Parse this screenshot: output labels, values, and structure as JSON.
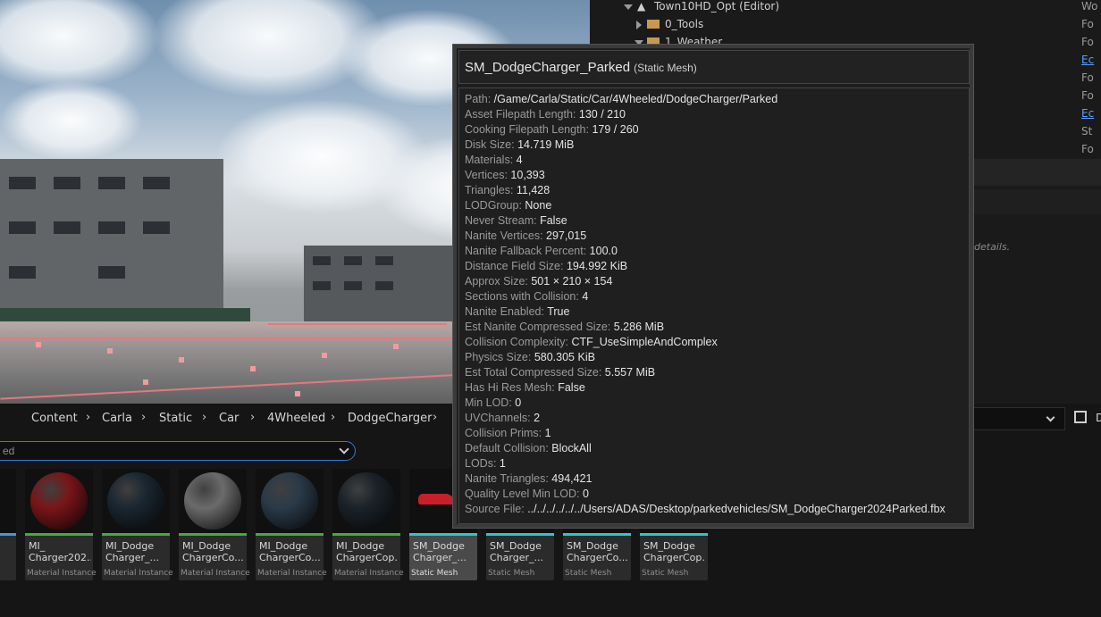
{
  "outliner": {
    "rows": [
      {
        "label": "Town10HD_Opt (Editor)",
        "type": "Wo"
      },
      {
        "label": "0_Tools",
        "type": "Fo"
      },
      {
        "label": "1_Weather",
        "type": "Fo"
      },
      {
        "label": "",
        "type": "Ec"
      },
      {
        "label": "",
        "type": "Fo"
      },
      {
        "label": "",
        "type": "Fo"
      },
      {
        "label": "",
        "type": "Ec"
      },
      {
        "label": "",
        "type": "St"
      },
      {
        "label": "",
        "type": "Fo"
      }
    ],
    "hint": "y details."
  },
  "breadcrumb": [
    "Content",
    "Carla",
    "Static",
    "Car",
    "4Wheeled",
    "DodgeCharger"
  ],
  "filter": {
    "value": "ed"
  },
  "right_label": "D",
  "tiles": [
    {
      "name": "",
      "kind": "s",
      "bar": "#3b9be0",
      "thumb": "#0a0a0a"
    },
    {
      "name": "MI_\nCharger202...",
      "kind": "Material Instance",
      "bar": "#3fae3a",
      "thumb": "#7a1518"
    },
    {
      "name": "MI_Dodge\nCharger_...",
      "kind": "Material Instance",
      "bar": "#3fae3a",
      "thumb": "#1a2630"
    },
    {
      "name": "MI_Dodge\nChargerCo...",
      "kind": "Material Instance",
      "bar": "#3fae3a",
      "thumb": "#6b6b6b"
    },
    {
      "name": "MI_Dodge\nChargerCo...",
      "kind": "Material Instance",
      "bar": "#3fae3a",
      "thumb": "#2a3a48"
    },
    {
      "name": "MI_Dodge\nChargerCop...",
      "kind": "Material Instance",
      "bar": "#3fae3a",
      "thumb": "#1a2228"
    },
    {
      "name": "SM_Dodge\nCharger_...",
      "kind": "Static Mesh",
      "bar": "#23c8d8",
      "thumb": "#151515",
      "selected": true
    },
    {
      "name": "SM_Dodge\nCharger_...",
      "kind": "Static Mesh",
      "bar": "#23c8d8",
      "thumb": "#151515"
    },
    {
      "name": "SM_Dodge\nChargerCo...",
      "kind": "Static Mesh",
      "bar": "#23c8d8",
      "thumb": "#151515"
    },
    {
      "name": "SM_Dodge\nChargerCop...",
      "kind": "Static Mesh",
      "bar": "#23c8d8",
      "thumb": "#151515"
    }
  ],
  "tooltip": {
    "title": "SM_DodgeCharger_Parked",
    "type": "(Static Mesh)",
    "rows": [
      {
        "k": "Path:",
        "v": "/Game/Carla/Static/Car/4Wheeled/DodgeCharger/Parked"
      },
      {
        "k": "Asset Filepath Length:",
        "v": "130 / 210"
      },
      {
        "k": "Cooking Filepath Length:",
        "v": "179 / 260"
      },
      {
        "k": "Disk Size:",
        "v": "14.719 MiB"
      },
      {
        "k": "Materials:",
        "v": "4"
      },
      {
        "k": "Vertices:",
        "v": "10,393"
      },
      {
        "k": "Triangles:",
        "v": "11,428"
      },
      {
        "k": "LODGroup:",
        "v": "None"
      },
      {
        "k": "Never Stream:",
        "v": "False"
      },
      {
        "k": "Nanite Vertices:",
        "v": "297,015"
      },
      {
        "k": "Nanite Fallback Percent:",
        "v": "100.0"
      },
      {
        "k": "Distance Field Size:",
        "v": "194.992 KiB"
      },
      {
        "k": "Approx Size:",
        "v": "501 × 210 × 154"
      },
      {
        "k": "Sections with Collision:",
        "v": "4"
      },
      {
        "k": "Nanite Enabled:",
        "v": "True"
      },
      {
        "k": "Est Nanite Compressed Size:",
        "v": "5.286 MiB"
      },
      {
        "k": "Collision Complexity:",
        "v": "CTF_UseSimpleAndComplex"
      },
      {
        "k": "Physics Size:",
        "v": "580.305 KiB"
      },
      {
        "k": "Est Total Compressed Size:",
        "v": "5.557 MiB"
      },
      {
        "k": "Has Hi Res Mesh:",
        "v": "False"
      },
      {
        "k": "Min LOD:",
        "v": "0"
      },
      {
        "k": "UVChannels:",
        "v": "2"
      },
      {
        "k": "Collision Prims:",
        "v": "1"
      },
      {
        "k": "Default Collision:",
        "v": "BlockAll"
      },
      {
        "k": "LODs:",
        "v": "1"
      },
      {
        "k": "Nanite Triangles:",
        "v": "494,421"
      },
      {
        "k": "Quality Level Min LOD:",
        "v": "0"
      },
      {
        "k": "Source File:",
        "v": "../../../../../../Users/ADAS/Desktop/parkedvehicles/SM_DodgeCharger2024Parked.fbx"
      }
    ]
  }
}
